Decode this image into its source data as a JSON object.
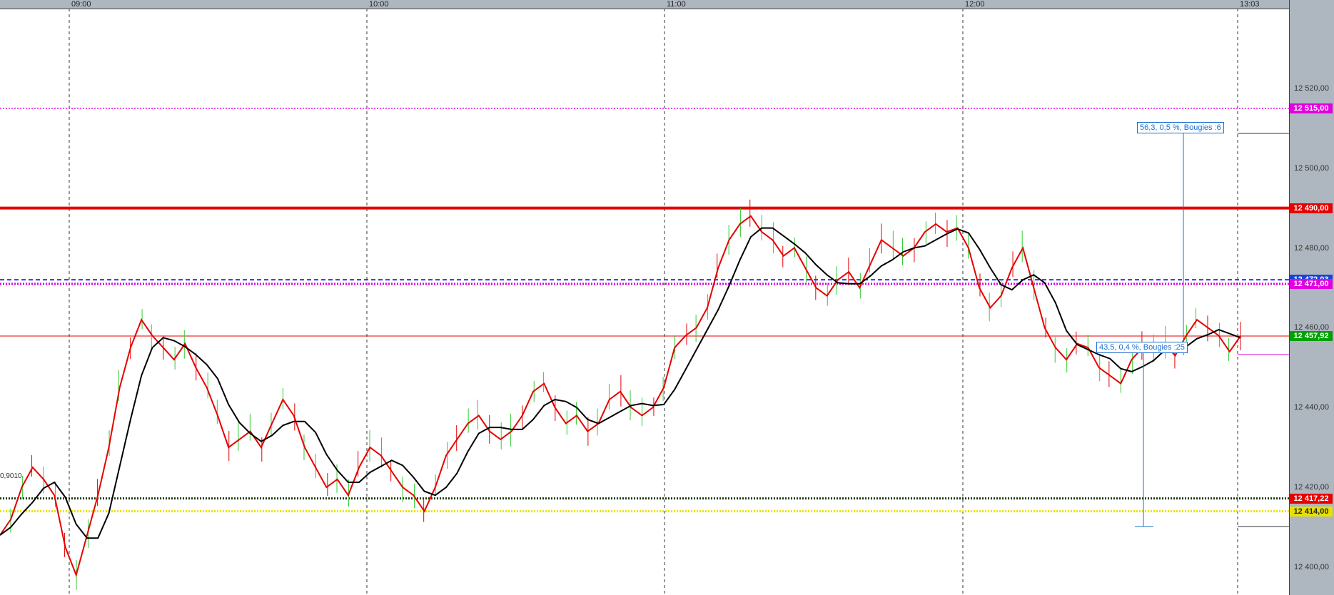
{
  "chart_data": {
    "type": "line",
    "instrument_style": "intraday price chart with moving averages",
    "time_labels": [
      "09:00",
      "10:00",
      "11:00",
      "12:00",
      "13:03"
    ],
    "y_ticks": [
      "12 520,00",
      "12 500,00",
      "12 480,00",
      "12 460,00",
      "12 440,00",
      "12 420,00",
      "12 400,00"
    ],
    "ylim": [
      12393,
      12540
    ],
    "grid": "vertical dashed lines at hours",
    "levels": [
      {
        "label": "12 515,00",
        "value": 12515.0,
        "color": "#e000e0",
        "style": "dotted"
      },
      {
        "label": "12 490,00",
        "value": 12490.0,
        "color": "#e60000",
        "style": "solid-thick"
      },
      {
        "label": "12 472,03",
        "value": 12472.03,
        "color": "#1f3fd8",
        "style": "dashed"
      },
      {
        "label": "12 471,00",
        "value": 12471.0,
        "color": "#e000e0",
        "style": "dotted-thick"
      },
      {
        "label": "12 457,92",
        "value": 12457.92,
        "color": "#e60000",
        "style": "thin"
      },
      {
        "label": "12 417,22",
        "value": 12417.22,
        "color": "#1a3a00",
        "style": "dotted-thick"
      },
      {
        "label": "12 414,00",
        "value": 12414.0,
        "color": "#e8e000",
        "style": "dotted-thick"
      }
    ],
    "current_price_label": "12 457,92",
    "price_series_close": [
      12408,
      12412,
      12420,
      12425,
      12422,
      12418,
      12405,
      12398,
      12408,
      12418,
      12430,
      12445,
      12455,
      12462,
      12458,
      12455,
      12452,
      12456,
      12450,
      12445,
      12438,
      12430,
      12432,
      12434,
      12430,
      12436,
      12442,
      12438,
      12430,
      12425,
      12420,
      12422,
      12418,
      12425,
      12430,
      12428,
      12424,
      12420,
      12418,
      12414,
      12420,
      12428,
      12432,
      12436,
      12438,
      12434,
      12432,
      12434,
      12438,
      12444,
      12446,
      12440,
      12436,
      12438,
      12434,
      12436,
      12442,
      12444,
      12440,
      12438,
      12440,
      12445,
      12455,
      12458,
      12460,
      12465,
      12475,
      12482,
      12486,
      12488,
      12484,
      12482,
      12478,
      12480,
      12475,
      12470,
      12468,
      12472,
      12474,
      12470,
      12476,
      12482,
      12480,
      12478,
      12480,
      12484,
      12486,
      12484,
      12485,
      12480,
      12470,
      12465,
      12468,
      12475,
      12480,
      12470,
      12460,
      12455,
      12452,
      12456,
      12455,
      12450,
      12448,
      12446,
      12452,
      12455,
      12454,
      12456,
      12453,
      12458,
      12462,
      12460,
      12458,
      12454,
      12457.92
    ],
    "series": [
      {
        "values": "price_series_close",
        "color": "#e60000"
      },
      {
        "values": "slow_ma",
        "color": "#000000"
      }
    ],
    "annotations": [
      {
        "text": "56,3, 0,5 %, Bougies :6",
        "color": "#1a6fd1"
      },
      {
        "text": "43,5, 0,4 %, Bougies :25",
        "color": "#1a6fd1"
      }
    ],
    "small_label": "0,9010"
  }
}
